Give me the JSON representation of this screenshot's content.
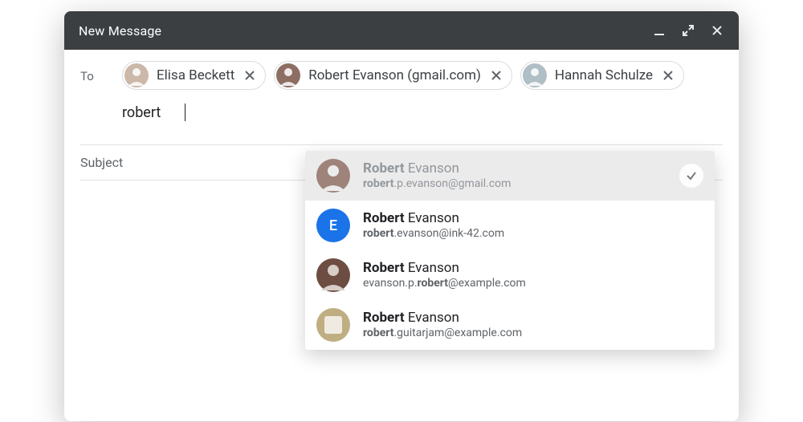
{
  "window": {
    "title": "New Message"
  },
  "compose": {
    "to_label": "To",
    "recipients": [
      {
        "name": "Elisa Beckett",
        "avatar_bg": "#cbb8a9"
      },
      {
        "name": "Robert Evanson (gmail.com)",
        "avatar_bg": "#8d6e63"
      },
      {
        "name": "Hannah Schulze",
        "avatar_bg": "#b0bec5"
      }
    ],
    "search_query": "robert",
    "subject_placeholder": "Subject"
  },
  "suggestions": [
    {
      "first": "Robert",
      "last": "Evanson",
      "email_prefix": "robert",
      "email_suffix": ".p.evanson@gmail.com",
      "already_added": true,
      "avatar_bg": "#8d6e63",
      "letter": ""
    },
    {
      "first": "Robert",
      "last": "Evanson",
      "email_prefix": "robert",
      "email_suffix": ".evanson@ink-42.com",
      "already_added": false,
      "avatar_bg": "#1a73e8",
      "letter": "E"
    },
    {
      "first": "Robert",
      "last": "Evanson",
      "email_pre": "evanson.p.",
      "email_prefix": "robert",
      "email_suffix": "@example.com",
      "already_added": false,
      "avatar_bg": "#6d4c41",
      "letter": ""
    },
    {
      "first": "Robert",
      "last": "Evanson",
      "email_prefix": "robert",
      "email_suffix": ".guitarjam@example.com",
      "already_added": false,
      "avatar_bg": "#bfae82",
      "letter": ""
    }
  ]
}
